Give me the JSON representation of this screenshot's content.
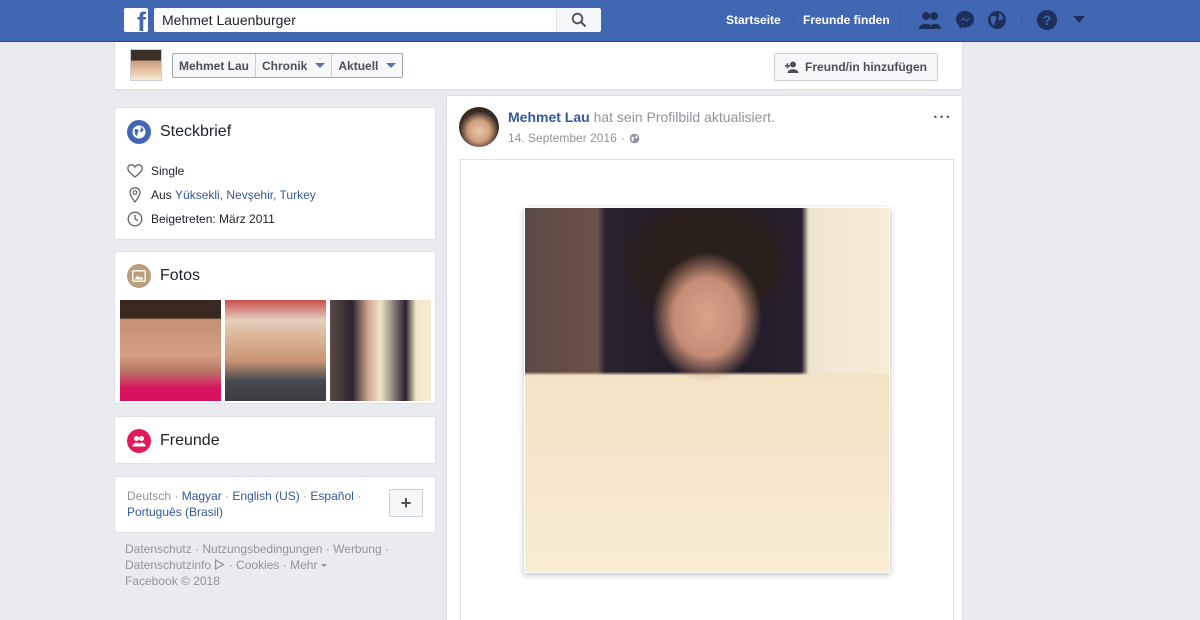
{
  "topbar": {
    "search_value": "Mehmet Lauenburger",
    "nav": [
      "Startseite",
      "Freunde finden"
    ],
    "icons": [
      "friend-requests-icon",
      "messenger-icon",
      "notifications-globe-icon",
      "help-icon",
      "account-menu-caret-icon"
    ]
  },
  "profile_nav": {
    "tabs": [
      "Mehmet Lau",
      "Chronik",
      "Aktuell"
    ],
    "add_friend_label": "Freund/in hinzufügen"
  },
  "intro": {
    "title": "Steckbrief",
    "relationship": "Single",
    "from_prefix": "Aus",
    "from_place": "Yüksekli, Nevşehir, Turkey",
    "joined": "Beigetreten: März 2011"
  },
  "photos": {
    "title": "Fotos"
  },
  "friends": {
    "title": "Freunde"
  },
  "languages": {
    "current": "Deutsch",
    "others": [
      "Magyar",
      "English (US)",
      "Español",
      "Português (Brasil)"
    ]
  },
  "footer": {
    "line1": [
      "Datenschutz",
      "Nutzungsbedingungen",
      "Werbung"
    ],
    "line2": [
      "Datenschutzinfo",
      "Cookies",
      "Mehr"
    ],
    "copyright": "Facebook © 2018"
  },
  "post": {
    "author": "Mehmet Lau",
    "action": "hat sein Profilbild aktualisiert.",
    "date": "14. September 2016",
    "more_label": "···"
  },
  "colors": {
    "brand_blue": "#4267b2",
    "link": "#365899",
    "background": "#e9ebee"
  }
}
